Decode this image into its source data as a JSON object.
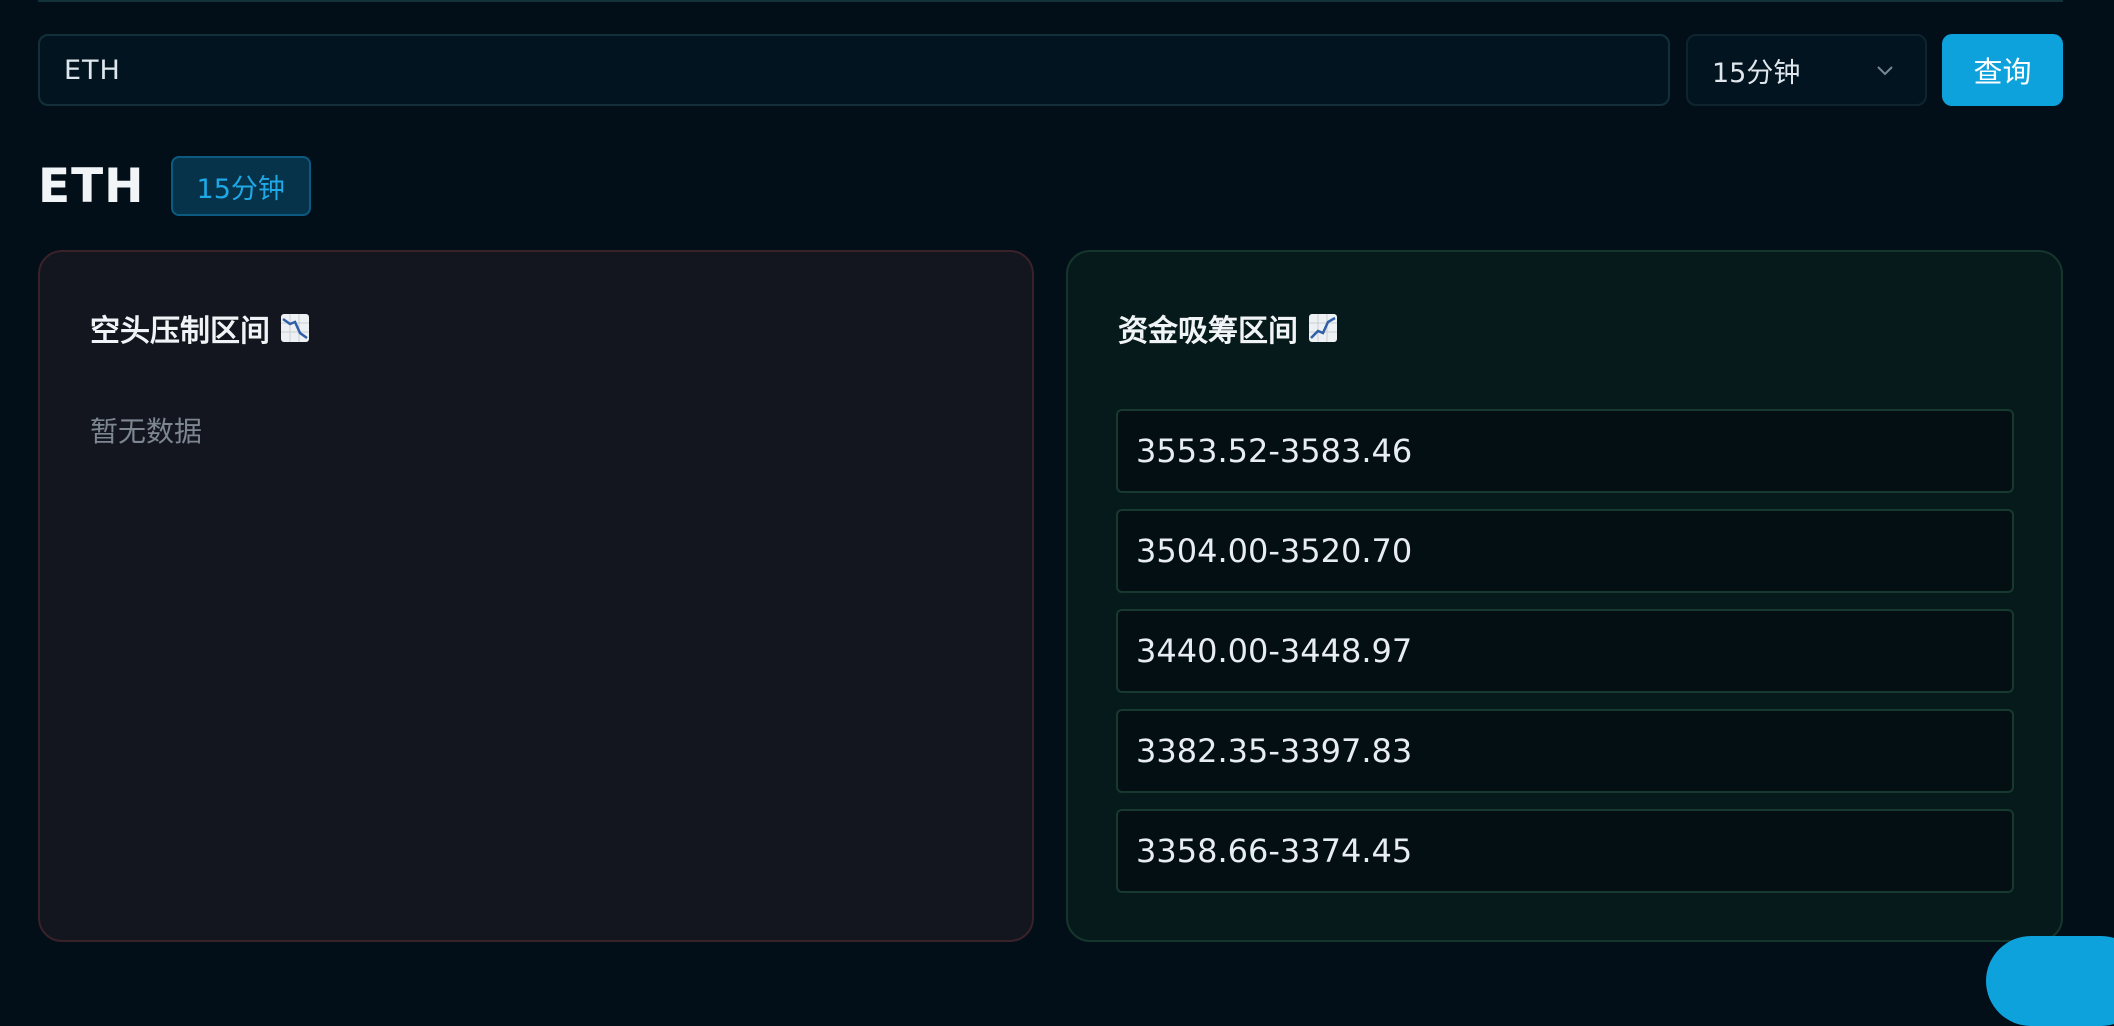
{
  "search": {
    "symbol_value": "ETH",
    "interval_selected": "15分钟",
    "query_label": "查询"
  },
  "header": {
    "title": "ETH",
    "badge": "15分钟"
  },
  "bear_panel": {
    "title": "空头压制区间",
    "icon": "chart-decreasing-icon",
    "empty_text": "暂无数据"
  },
  "bull_panel": {
    "title": "资金吸筹区间",
    "icon": "chart-increasing-icon",
    "zones": [
      "3553.52-3583.46",
      "3504.00-3520.70",
      "3440.00-3448.97",
      "3382.35-3397.83",
      "3358.66-3374.45"
    ]
  },
  "colors": {
    "accent": "#0ea2dc",
    "background": "#020f18",
    "bear_border": "#3a2229",
    "bull_border": "#16352c"
  }
}
